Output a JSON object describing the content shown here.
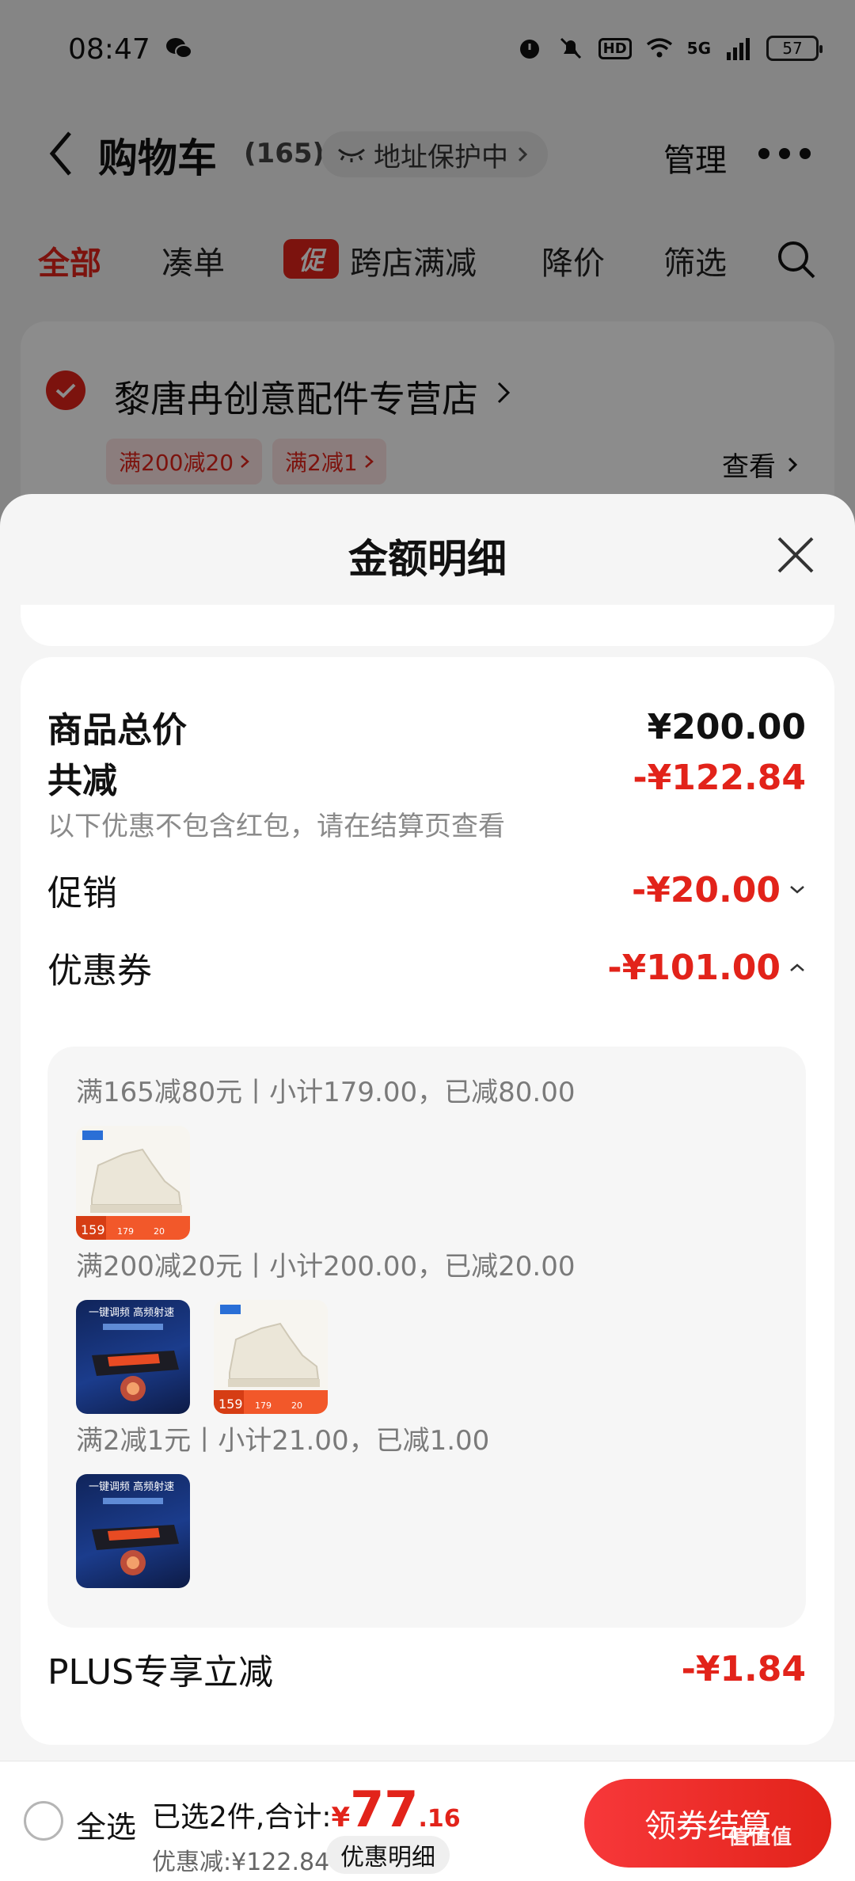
{
  "status_bar": {
    "time": "08:47",
    "network": "5G",
    "battery": "57",
    "hd": "HD"
  },
  "nav": {
    "title": "购物车",
    "count": "(165)",
    "address_protect": "地址保护中",
    "manage": "管理"
  },
  "filters": {
    "all": "全部",
    "combine": "凑单",
    "promo_badge": "促",
    "cross_store": "跨店满减",
    "price_drop": "降价",
    "filter": "筛选"
  },
  "store": {
    "name": "黎唐冉创意配件专营店",
    "tag1": "满200减20",
    "tag2": "满2减1",
    "view": "查看"
  },
  "sheet": {
    "title": "金额明细",
    "total_label": "商品总价",
    "total_value": "¥200.00",
    "reduce_label": "共减",
    "reduce_value": "-¥122.84",
    "reduce_note": "以下优惠不包含红包，请在结算页查看",
    "promo_label": "促销",
    "promo_value": "-¥20.00",
    "coupon_label": "优惠券",
    "coupon_value": "-¥101.00",
    "coupon_lines": [
      "满165减80元丨小计179.00，已减80.00",
      "满200减20元丨小计200.00，已减20.00",
      "满2减1元丨小计21.00，已减1.00"
    ],
    "plus_label": "PLUS专享立减",
    "plus_value": "-¥1.84"
  },
  "bottom_bar": {
    "select_all": "全选",
    "selected_text": "已选2件,合计:",
    "currency": "¥",
    "total_int": "77",
    "total_dec": ".16",
    "discount": "优惠减:¥122.84",
    "detail": "优惠明细",
    "checkout": "领券结算"
  },
  "thumb_labels": {
    "shoe_price": "159",
    "shoe_orig": "179",
    "shoe_off": "20",
    "fan_caption": "一键调频 高频射速"
  },
  "watermark": "值值值",
  "colors": {
    "accent": "#e2231a",
    "sheet_bg": "#f5f5f5",
    "card_bg": "#ffffff"
  }
}
